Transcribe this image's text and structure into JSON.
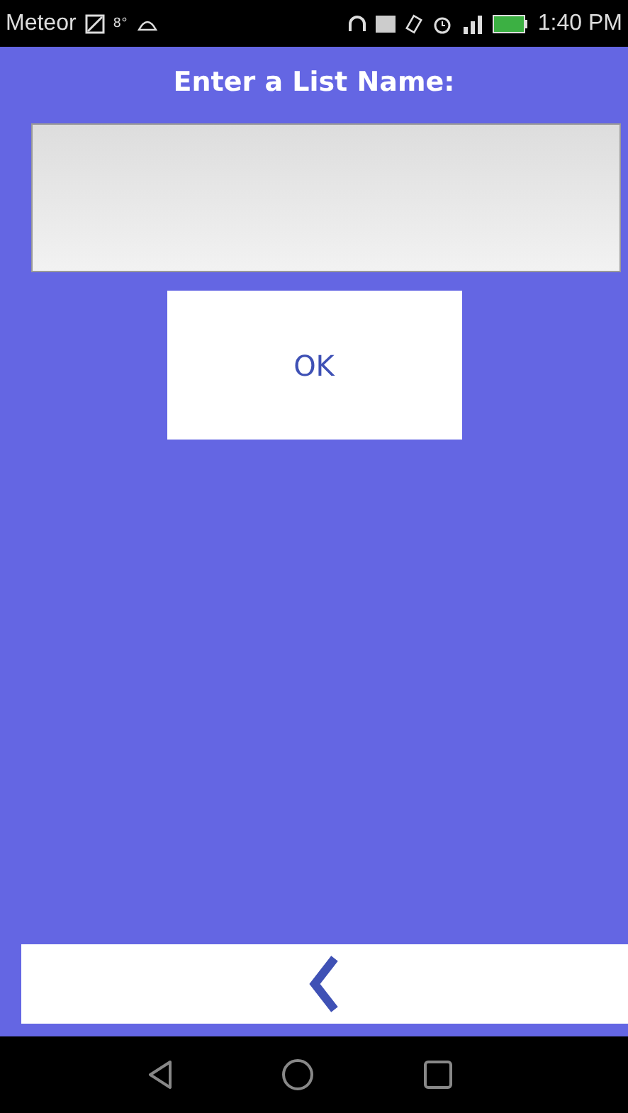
{
  "status_bar": {
    "carrier": "Meteor",
    "temperature": "8°",
    "time": "1:40 PM"
  },
  "title": "Enter a List Name:",
  "ok_button": {
    "label": "OK"
  }
}
